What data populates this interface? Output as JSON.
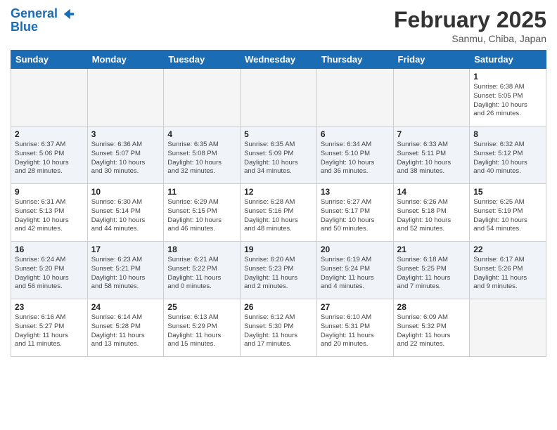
{
  "logo": {
    "line1": "General",
    "line2": "Blue"
  },
  "title": "February 2025",
  "subtitle": "Sanmu, Chiba, Japan",
  "days_of_week": [
    "Sunday",
    "Monday",
    "Tuesday",
    "Wednesday",
    "Thursday",
    "Friday",
    "Saturday"
  ],
  "weeks": [
    {
      "alt": false,
      "days": [
        {
          "num": "",
          "info": ""
        },
        {
          "num": "",
          "info": ""
        },
        {
          "num": "",
          "info": ""
        },
        {
          "num": "",
          "info": ""
        },
        {
          "num": "",
          "info": ""
        },
        {
          "num": "",
          "info": ""
        },
        {
          "num": "1",
          "info": "Sunrise: 6:38 AM\nSunset: 5:05 PM\nDaylight: 10 hours\nand 26 minutes."
        }
      ]
    },
    {
      "alt": true,
      "days": [
        {
          "num": "2",
          "info": "Sunrise: 6:37 AM\nSunset: 5:06 PM\nDaylight: 10 hours\nand 28 minutes."
        },
        {
          "num": "3",
          "info": "Sunrise: 6:36 AM\nSunset: 5:07 PM\nDaylight: 10 hours\nand 30 minutes."
        },
        {
          "num": "4",
          "info": "Sunrise: 6:35 AM\nSunset: 5:08 PM\nDaylight: 10 hours\nand 32 minutes."
        },
        {
          "num": "5",
          "info": "Sunrise: 6:35 AM\nSunset: 5:09 PM\nDaylight: 10 hours\nand 34 minutes."
        },
        {
          "num": "6",
          "info": "Sunrise: 6:34 AM\nSunset: 5:10 PM\nDaylight: 10 hours\nand 36 minutes."
        },
        {
          "num": "7",
          "info": "Sunrise: 6:33 AM\nSunset: 5:11 PM\nDaylight: 10 hours\nand 38 minutes."
        },
        {
          "num": "8",
          "info": "Sunrise: 6:32 AM\nSunset: 5:12 PM\nDaylight: 10 hours\nand 40 minutes."
        }
      ]
    },
    {
      "alt": false,
      "days": [
        {
          "num": "9",
          "info": "Sunrise: 6:31 AM\nSunset: 5:13 PM\nDaylight: 10 hours\nand 42 minutes."
        },
        {
          "num": "10",
          "info": "Sunrise: 6:30 AM\nSunset: 5:14 PM\nDaylight: 10 hours\nand 44 minutes."
        },
        {
          "num": "11",
          "info": "Sunrise: 6:29 AM\nSunset: 5:15 PM\nDaylight: 10 hours\nand 46 minutes."
        },
        {
          "num": "12",
          "info": "Sunrise: 6:28 AM\nSunset: 5:16 PM\nDaylight: 10 hours\nand 48 minutes."
        },
        {
          "num": "13",
          "info": "Sunrise: 6:27 AM\nSunset: 5:17 PM\nDaylight: 10 hours\nand 50 minutes."
        },
        {
          "num": "14",
          "info": "Sunrise: 6:26 AM\nSunset: 5:18 PM\nDaylight: 10 hours\nand 52 minutes."
        },
        {
          "num": "15",
          "info": "Sunrise: 6:25 AM\nSunset: 5:19 PM\nDaylight: 10 hours\nand 54 minutes."
        }
      ]
    },
    {
      "alt": true,
      "days": [
        {
          "num": "16",
          "info": "Sunrise: 6:24 AM\nSunset: 5:20 PM\nDaylight: 10 hours\nand 56 minutes."
        },
        {
          "num": "17",
          "info": "Sunrise: 6:23 AM\nSunset: 5:21 PM\nDaylight: 10 hours\nand 58 minutes."
        },
        {
          "num": "18",
          "info": "Sunrise: 6:21 AM\nSunset: 5:22 PM\nDaylight: 11 hours\nand 0 minutes."
        },
        {
          "num": "19",
          "info": "Sunrise: 6:20 AM\nSunset: 5:23 PM\nDaylight: 11 hours\nand 2 minutes."
        },
        {
          "num": "20",
          "info": "Sunrise: 6:19 AM\nSunset: 5:24 PM\nDaylight: 11 hours\nand 4 minutes."
        },
        {
          "num": "21",
          "info": "Sunrise: 6:18 AM\nSunset: 5:25 PM\nDaylight: 11 hours\nand 7 minutes."
        },
        {
          "num": "22",
          "info": "Sunrise: 6:17 AM\nSunset: 5:26 PM\nDaylight: 11 hours\nand 9 minutes."
        }
      ]
    },
    {
      "alt": false,
      "days": [
        {
          "num": "23",
          "info": "Sunrise: 6:16 AM\nSunset: 5:27 PM\nDaylight: 11 hours\nand 11 minutes."
        },
        {
          "num": "24",
          "info": "Sunrise: 6:14 AM\nSunset: 5:28 PM\nDaylight: 11 hours\nand 13 minutes."
        },
        {
          "num": "25",
          "info": "Sunrise: 6:13 AM\nSunset: 5:29 PM\nDaylight: 11 hours\nand 15 minutes."
        },
        {
          "num": "26",
          "info": "Sunrise: 6:12 AM\nSunset: 5:30 PM\nDaylight: 11 hours\nand 17 minutes."
        },
        {
          "num": "27",
          "info": "Sunrise: 6:10 AM\nSunset: 5:31 PM\nDaylight: 11 hours\nand 20 minutes."
        },
        {
          "num": "28",
          "info": "Sunrise: 6:09 AM\nSunset: 5:32 PM\nDaylight: 11 hours\nand 22 minutes."
        },
        {
          "num": "",
          "info": ""
        }
      ]
    }
  ]
}
